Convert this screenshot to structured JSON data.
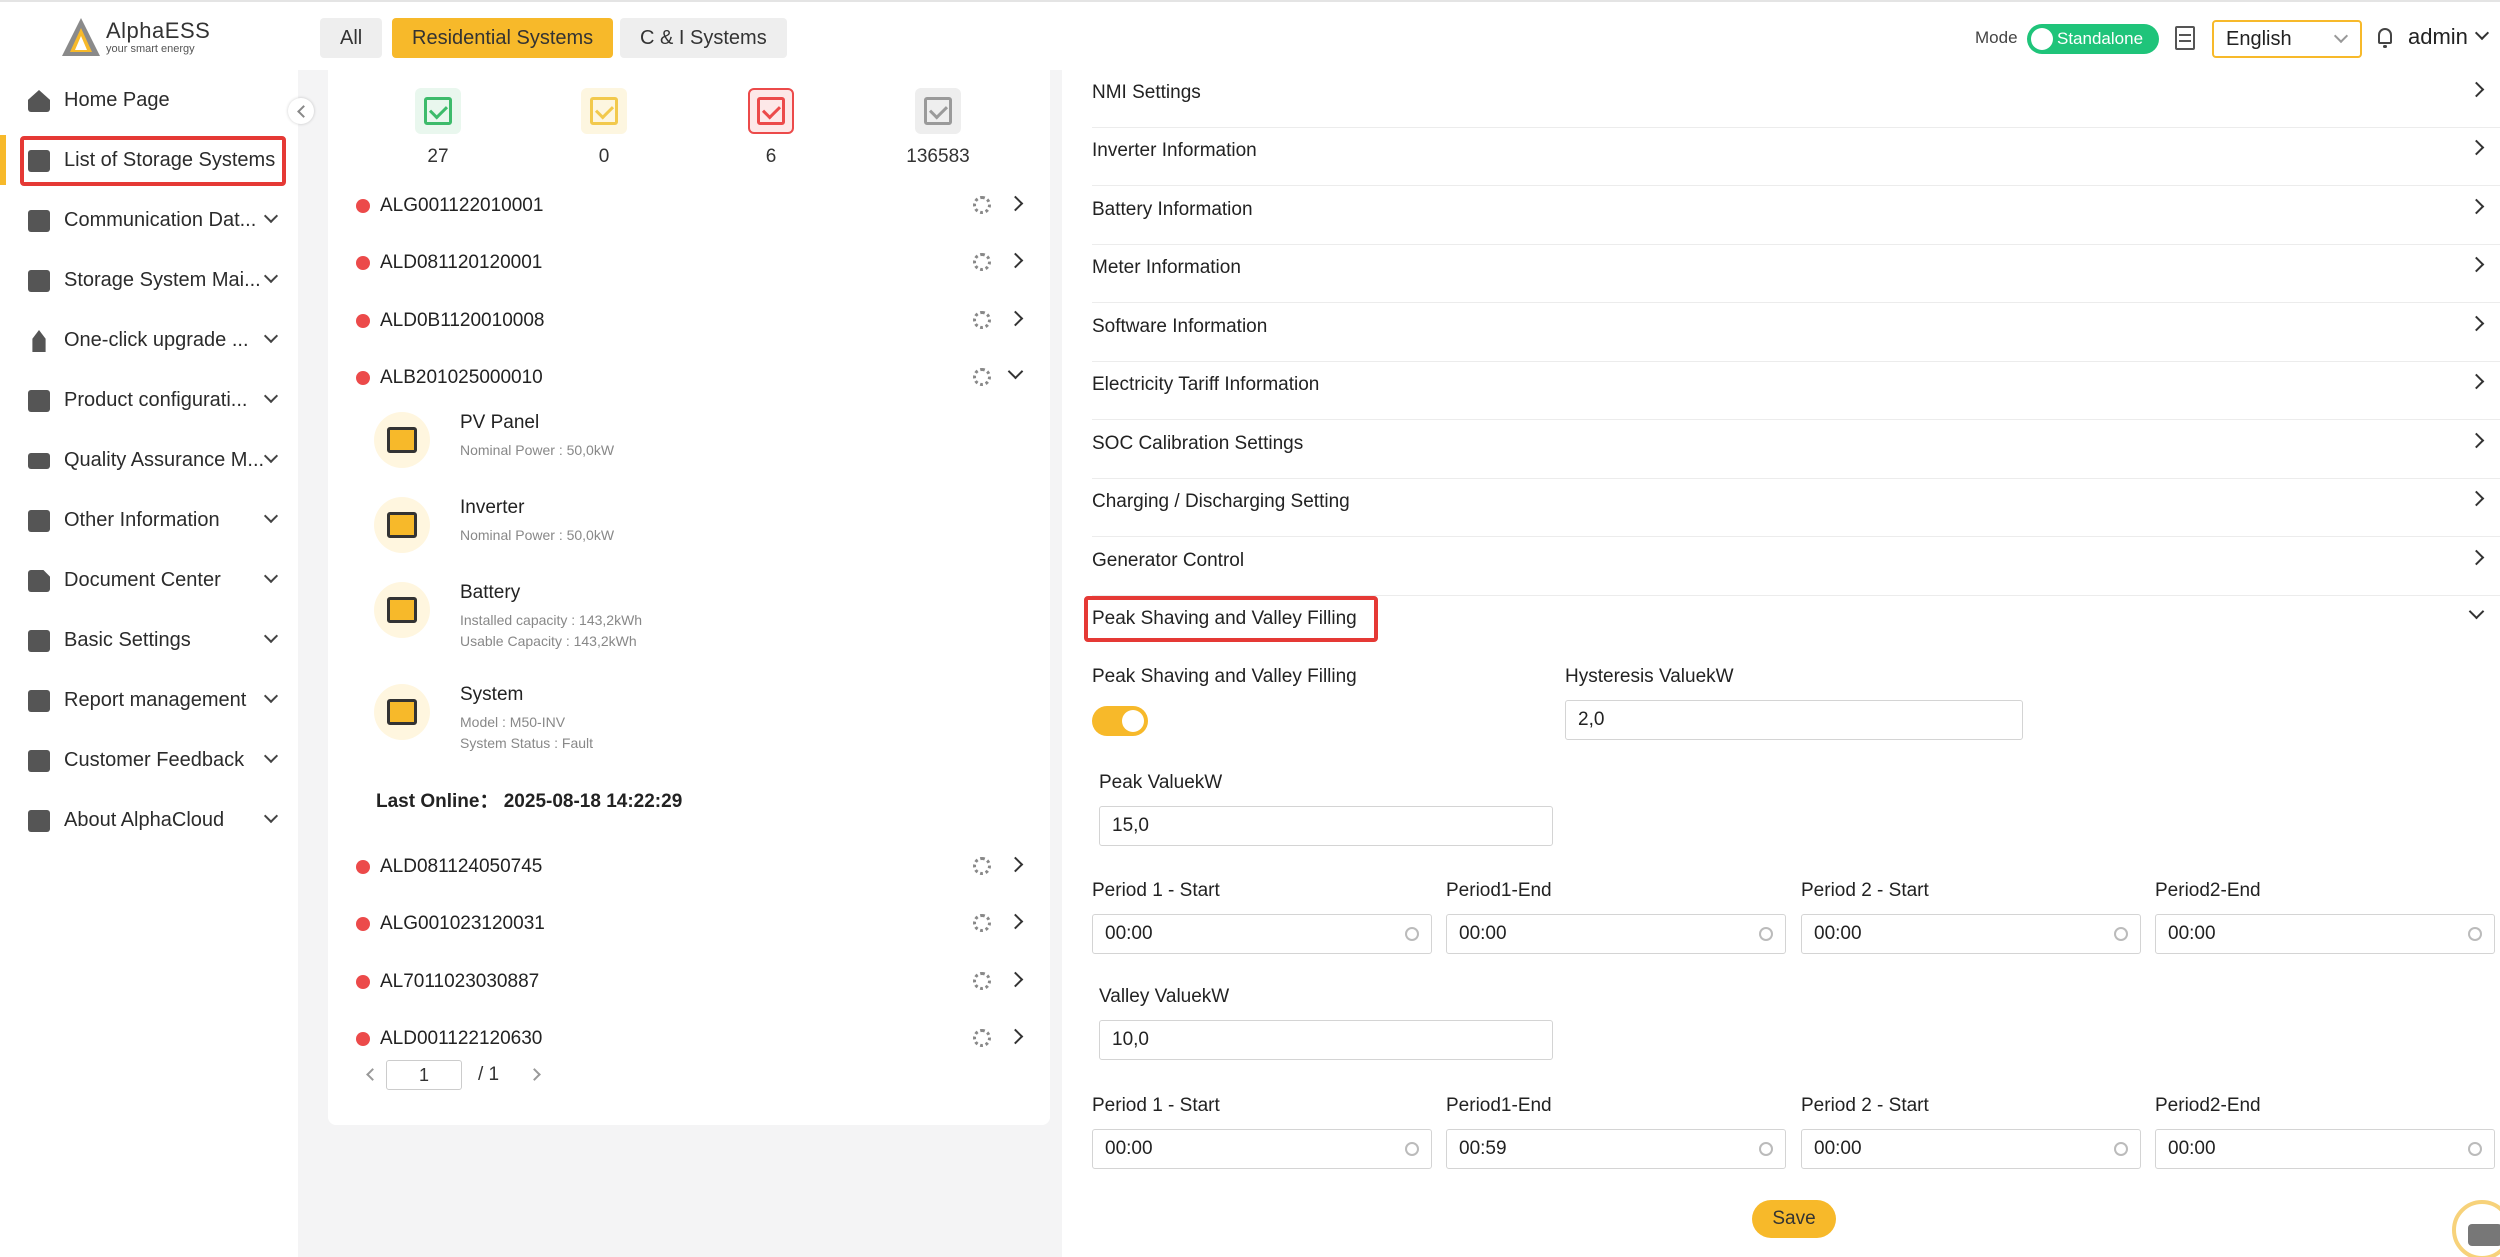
{
  "header": {
    "logo_name": "AlphaESS",
    "logo_tagline": "your smart energy",
    "tabs": [
      {
        "label": "All"
      },
      {
        "label": "Residential Systems"
      },
      {
        "label": "C & I Systems"
      }
    ],
    "mode_label": "Mode",
    "mode_value": "Standalone",
    "language": "English",
    "user": "admin"
  },
  "sidebar": {
    "items": [
      {
        "label": "Home Page",
        "icon": "home-icon"
      },
      {
        "label": "List of Storage Systems",
        "icon": "list-icon"
      },
      {
        "label": "Communication Dat...",
        "icon": "user-icon"
      },
      {
        "label": "Storage System Mai...",
        "icon": "search-icon"
      },
      {
        "label": "One-click upgrade ...",
        "icon": "rocket-icon"
      },
      {
        "label": "Product configurati...",
        "icon": "box-icon"
      },
      {
        "label": "Quality Assurance M...",
        "icon": "card-icon"
      },
      {
        "label": "Other Information",
        "icon": "dots-icon"
      },
      {
        "label": "Document Center",
        "icon": "document-icon"
      },
      {
        "label": "Basic Settings",
        "icon": "gear-icon"
      },
      {
        "label": "Report management",
        "icon": "report-icon"
      },
      {
        "label": "Customer Feedback",
        "icon": "chat-icon"
      },
      {
        "label": "About AlphaCloud",
        "icon": "people-icon"
      }
    ]
  },
  "stats": [
    {
      "value": "27",
      "color": "#3dbb6b"
    },
    {
      "value": "0",
      "color": "#f2c94c"
    },
    {
      "value": "6",
      "color": "#ec4a4a"
    },
    {
      "value": "136583",
      "color": "#9a9a9a"
    }
  ],
  "systems_top": [
    {
      "id": "ALG001122010001"
    },
    {
      "id": "ALD081120120001"
    },
    {
      "id": "ALD0B1120010008"
    },
    {
      "id": "ALB201025000010"
    }
  ],
  "components": {
    "pv": {
      "title": "PV Panel",
      "line1": "Nominal Power : 50,0kW"
    },
    "inverter": {
      "title": "Inverter",
      "line1": "Nominal Power : 50,0kW"
    },
    "battery": {
      "title": "Battery",
      "line1": "Installed capacity : 143,2kWh",
      "line2": "Usable Capacity : 143,2kWh"
    },
    "system": {
      "title": "System",
      "line1": "Model : M50-INV",
      "line2": "System Status : Fault"
    }
  },
  "last_online": "Last Online： 2025-08-18 14:22:29",
  "systems_bottom": [
    {
      "id": "ALD081124050745"
    },
    {
      "id": "ALG001023120031"
    },
    {
      "id": "AL7011023030887"
    },
    {
      "id": "ALD001122120630"
    }
  ],
  "pager": {
    "current": "1",
    "total": "/  1"
  },
  "settings": {
    "sections": [
      {
        "label": "NMI Settings"
      },
      {
        "label": "Inverter Information"
      },
      {
        "label": "Battery Information"
      },
      {
        "label": "Meter Information"
      },
      {
        "label": "Software Information"
      },
      {
        "label": "Electricity Tariff Information"
      },
      {
        "label": "SOC Calibration Settings"
      },
      {
        "label": "Charging / Discharging Setting"
      },
      {
        "label": "Generator Control"
      },
      {
        "label": "Peak Shaving and Valley Filling"
      }
    ],
    "peak": {
      "toggle_label": "Peak Shaving and Valley Filling",
      "hysteresis_label": "Hysteresis ValuekW",
      "hysteresis_value": "2,0",
      "peak_label": "Peak ValuekW",
      "peak_value": "15,0",
      "valley_label": "Valley ValuekW",
      "valley_value": "10,0",
      "peak_periods": [
        {
          "label": "Period 1 - Start",
          "value": "00:00"
        },
        {
          "label": "Period1-End",
          "value": "00:00"
        },
        {
          "label": "Period 2 - Start",
          "value": "00:00"
        },
        {
          "label": "Period2-End",
          "value": "00:00"
        }
      ],
      "valley_periods": [
        {
          "label": "Period 1 - Start",
          "value": "00:00"
        },
        {
          "label": "Period1-End",
          "value": "00:59"
        },
        {
          "label": "Period 2 - Start",
          "value": "00:00"
        },
        {
          "label": "Period2-End",
          "value": "00:00"
        }
      ],
      "save_label": "Save"
    }
  },
  "colors": {
    "accent": "#f7b92a",
    "success": "#1fc47a",
    "error": "#ec4a4a",
    "highlight": "#e53935"
  }
}
